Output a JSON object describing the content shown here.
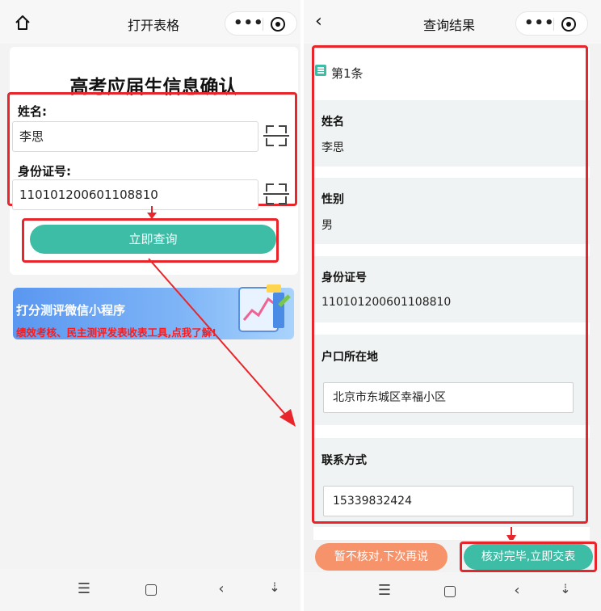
{
  "left": {
    "nav": {
      "title": "打开表格"
    },
    "form": {
      "title": "高考应届生信息确认",
      "name_label": "姓名:",
      "name_value": "李思",
      "id_label": "身份证号:",
      "id_value": "110101200601108810",
      "submit_label": "立即查询"
    },
    "banner": {
      "title": "打分测评微信小程序",
      "subtitle": "绩效考核、民主测评发表收表工具,点我了解!"
    }
  },
  "right": {
    "nav": {
      "title": "查询结果"
    },
    "record_label": "第1条",
    "fields": {
      "name_label": "姓名",
      "name_value": "李思",
      "gender_label": "性别",
      "gender_value": "男",
      "id_label": "身份证号",
      "id_value": "110101200601108810",
      "address_label": "户口所在地",
      "address_value": "北京市东城区幸福小区",
      "contact_label": "联系方式",
      "contact_value": "15339832424"
    },
    "buttons": {
      "later_label": "暂不核对,下次再说",
      "confirm_label": "核对完毕,立即交表"
    }
  },
  "colors": {
    "accent": "#3dbca6",
    "highlight_red": "#e8252a",
    "orange": "#f7936b"
  },
  "icons": [
    "home-icon",
    "more-icon",
    "target-icon",
    "back-icon",
    "scan-icon",
    "list-icon",
    "menu-icon",
    "square-icon",
    "chevron-left-icon",
    "down-arrow-icon"
  ]
}
